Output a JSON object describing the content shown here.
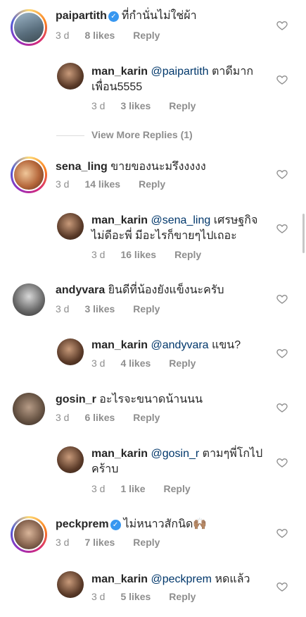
{
  "comments": [
    {
      "user": "paipartith",
      "verified": true,
      "text": "ที่กำนั่นไม่ใช่ผ้า",
      "time": "3 d",
      "likes": "8 likes",
      "reply": "Reply"
    },
    {
      "user": "man_karin",
      "mention": "@paipartith",
      "text": "ตาดีมาก",
      "text2": "เพื่อน5555",
      "time": "3 d",
      "likes": "3 likes",
      "reply": "Reply"
    },
    {
      "view_more": "View More Replies (1)"
    },
    {
      "user": "sena_ling",
      "text": "ขายของนะมรึงงงงง",
      "time": "3 d",
      "likes": "14 likes",
      "reply": "Reply"
    },
    {
      "user": "man_karin",
      "mention": "@sena_ling",
      "text": "เศรษฐกิจ",
      "text2": "ไม่ดีอะพี่ มีอะไรก็ขายๆไปเถอะ",
      "time": "3 d",
      "likes": "16 likes",
      "reply": "Reply"
    },
    {
      "user": "andyvara",
      "text": "ยินดีที่น้องยังแข็งนะครับ",
      "time": "3 d",
      "likes": "3 likes",
      "reply": "Reply"
    },
    {
      "user": "man_karin",
      "mention": "@andyvara",
      "text": "แขน?",
      "time": "3 d",
      "likes": "4 likes",
      "reply": "Reply"
    },
    {
      "user": "gosin_r",
      "text": "อะไรจะขนาดน้านนน",
      "time": "3 d",
      "likes": "6 likes",
      "reply": "Reply"
    },
    {
      "user": "man_karin",
      "mention": "@gosin_r",
      "text": "ตามๆพี่โกไป",
      "text2": "คร้าบ",
      "time": "3 d",
      "likes": "1 like",
      "reply": "Reply"
    },
    {
      "user": "peckprem",
      "verified": true,
      "text": "ไม่หนาวสักนิด🙌🏽",
      "time": "3 d",
      "likes": "7 likes",
      "reply": "Reply"
    },
    {
      "user": "man_karin",
      "mention": "@peckprem",
      "text": "หดแล้ว",
      "time": "3 d",
      "likes": "5 likes",
      "reply": "Reply"
    }
  ],
  "icons": {
    "heart": "heart-outline-icon",
    "verified": "verified-badge-icon"
  },
  "colors": {
    "mention": "#00376b",
    "meta": "#8e8e8e",
    "verified": "#3897f0"
  }
}
